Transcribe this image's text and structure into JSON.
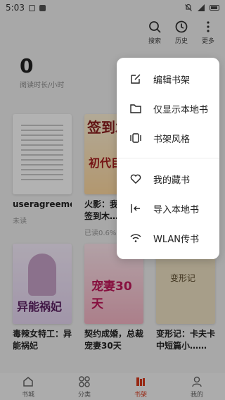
{
  "status_bar": {
    "time": "5:03"
  },
  "topbar": {
    "search_label": "搜索",
    "history_label": "历史",
    "more_label": "更多"
  },
  "reading": {
    "value": "0",
    "label": "阅读时长/小时"
  },
  "books": [
    {
      "title": "useragreement",
      "status": "未读"
    },
    {
      "title": "火影：我……局签到木……",
      "status": "已读0.6%",
      "cover_big": "签到木",
      "cover_sub": "初代目"
    },
    {
      "title": "毒辣女特工：异能祸妃",
      "status": "",
      "cover_text": "异能祸妃"
    },
    {
      "title": "契约成婚，总裁宠妻30天",
      "status": "",
      "cover_text": "宠妻30天"
    },
    {
      "title": "变形记：卡夫卡中短篇小……",
      "status": "",
      "cover_text": "变形记"
    }
  ],
  "menu": {
    "items": [
      {
        "label": "编辑书架",
        "icon": "edit-icon"
      },
      {
        "label": "仅显示本地书",
        "icon": "folder-icon"
      },
      {
        "label": "书架风格",
        "icon": "style-icon"
      },
      {
        "label": "我的藏书",
        "icon": "heart-icon"
      },
      {
        "label": "导入本地书",
        "icon": "import-icon"
      },
      {
        "label": "WLAN传书",
        "icon": "wifi-icon"
      }
    ]
  },
  "bottom_nav": [
    {
      "label": "书城"
    },
    {
      "label": "分类"
    },
    {
      "label": "书架"
    },
    {
      "label": "我的"
    }
  ],
  "colors": {
    "accent": "#d9391b"
  }
}
